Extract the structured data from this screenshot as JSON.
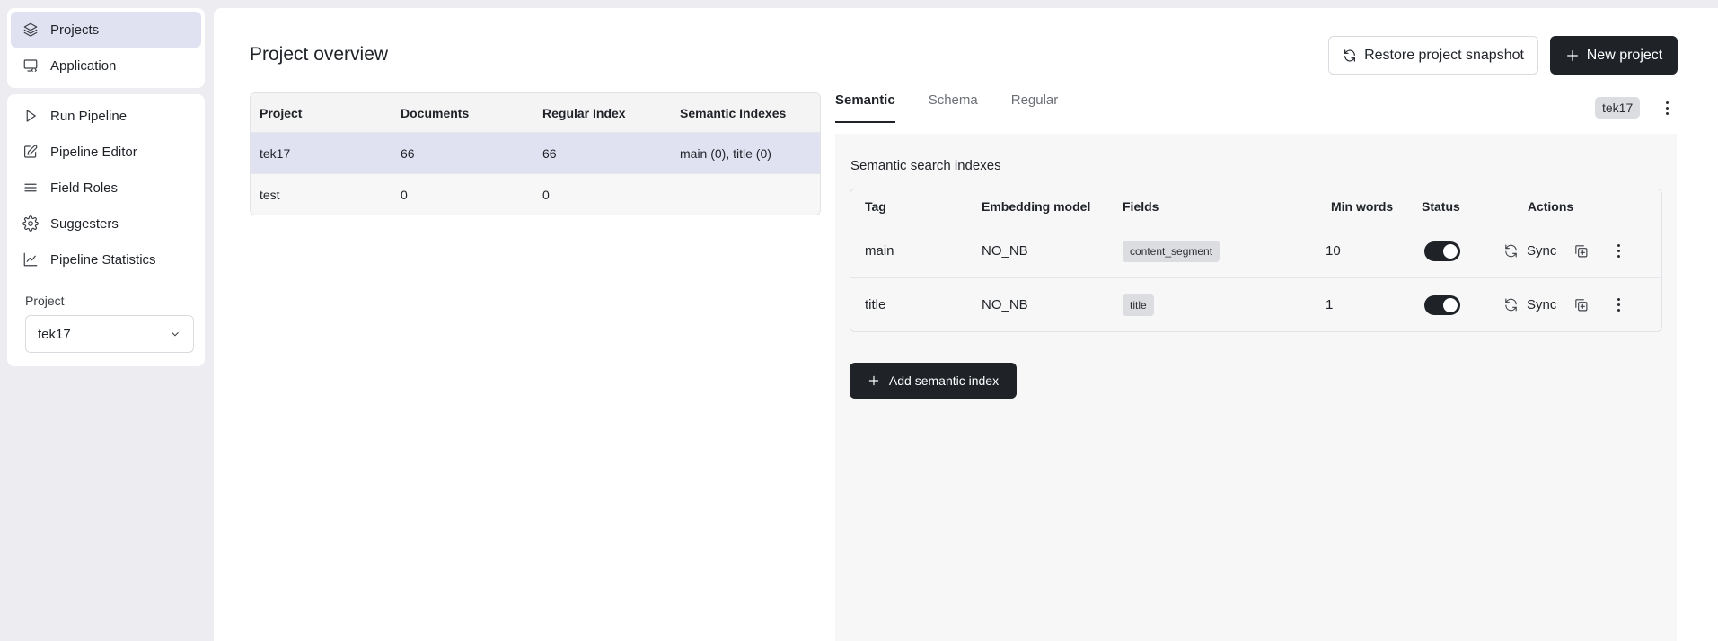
{
  "sidebar": {
    "top_items": [
      {
        "label": "Projects",
        "icon": "layers-icon",
        "active": true
      },
      {
        "label": "Application",
        "icon": "monitor-code-icon",
        "active": false
      }
    ],
    "items": [
      {
        "label": "Run Pipeline",
        "icon": "play-icon"
      },
      {
        "label": "Pipeline Editor",
        "icon": "edit-icon"
      },
      {
        "label": "Field Roles",
        "icon": "list-icon"
      },
      {
        "label": "Suggesters",
        "icon": "gear-icon"
      },
      {
        "label": "Pipeline Statistics",
        "icon": "line-chart-icon"
      }
    ],
    "project_label": "Project",
    "project_value": "tek17"
  },
  "header": {
    "title": "Project overview",
    "restore_label": "Restore project snapshot",
    "new_label": "New project"
  },
  "projects_table": {
    "columns": [
      "Project",
      "Documents",
      "Regular Index",
      "Semantic Indexes"
    ],
    "rows": [
      {
        "project": "tek17",
        "documents": "66",
        "regular": "66",
        "semantic": "main (0), title (0)",
        "selected": true
      },
      {
        "project": "test",
        "documents": "0",
        "regular": "0",
        "semantic": "",
        "selected": false
      }
    ]
  },
  "tabs": {
    "items": [
      "Semantic",
      "Schema",
      "Regular"
    ],
    "active": "Semantic",
    "project_badge": "tek17"
  },
  "semantic": {
    "title": "Semantic search indexes",
    "columns": [
      "Tag",
      "Embedding model",
      "Fields",
      "Min words",
      "Status",
      "Actions"
    ],
    "rows": [
      {
        "tag": "main",
        "model": "NO_NB",
        "field": "content_segment",
        "min_words": "10",
        "enabled": true,
        "sync": "Sync"
      },
      {
        "tag": "title",
        "model": "NO_NB",
        "field": "title",
        "min_words": "1",
        "enabled": true,
        "sync": "Sync"
      }
    ],
    "add_label": "Add semantic index"
  },
  "colors": {
    "background": "#ececf1",
    "active_nav": "#e0e2f1",
    "dark_button": "#1f2328",
    "panel": "#f7f7f8"
  }
}
